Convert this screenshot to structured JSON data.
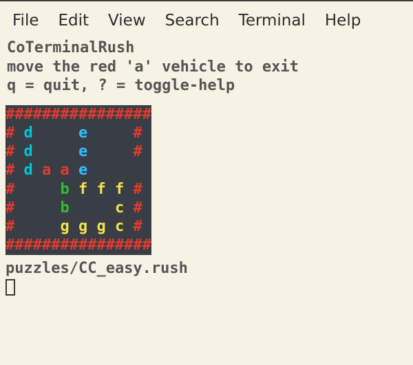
{
  "menubar": {
    "file": "File",
    "edit": "Edit",
    "view": "View",
    "search": "Search",
    "terminal": "Terminal",
    "help": "Help"
  },
  "header": {
    "title": "CoTerminalRush",
    "instruction": "move the red 'a' vehicle to exit",
    "keys": "q = quit,  ? = toggle-help"
  },
  "board": {
    "rows": [
      [
        [
          "wall",
          "################"
        ]
      ],
      [
        [
          "wall",
          "# "
        ],
        [
          "cyan",
          "d "
        ],
        [
          "gap",
          "    "
        ],
        [
          "blue",
          "e "
        ],
        [
          "gap",
          "    "
        ],
        [
          "wall",
          "#"
        ]
      ],
      [
        [
          "wall",
          "# "
        ],
        [
          "cyan",
          "d "
        ],
        [
          "gap",
          "    "
        ],
        [
          "blue",
          "e "
        ],
        [
          "gap",
          "    "
        ],
        [
          "wall",
          "#"
        ]
      ],
      [
        [
          "wall",
          "# "
        ],
        [
          "cyan",
          "d "
        ],
        [
          "red",
          "a "
        ],
        [
          "red",
          "a "
        ],
        [
          "blue",
          "e "
        ],
        [
          "gap",
          "     "
        ]
      ],
      [
        [
          "wall",
          "#"
        ],
        [
          "gap",
          "     "
        ],
        [
          "green",
          "b "
        ],
        [
          "yellow",
          "f "
        ],
        [
          "yellow",
          "f "
        ],
        [
          "yellow",
          "f "
        ],
        [
          "wall",
          "#"
        ]
      ],
      [
        [
          "wall",
          "#"
        ],
        [
          "gap",
          "     "
        ],
        [
          "green",
          "b "
        ],
        [
          "gap",
          "    "
        ],
        [
          "yellow",
          "c "
        ],
        [
          "wall",
          "#"
        ]
      ],
      [
        [
          "wall",
          "#"
        ],
        [
          "gap",
          "     "
        ],
        [
          "yellow",
          "g "
        ],
        [
          "yellow",
          "g "
        ],
        [
          "yellow",
          "g "
        ],
        [
          "yellow",
          "c "
        ],
        [
          "wall",
          "#"
        ]
      ],
      [
        [
          "wall",
          "################"
        ]
      ]
    ]
  },
  "footer": {
    "path": "puzzles/CC_easy.rush"
  }
}
